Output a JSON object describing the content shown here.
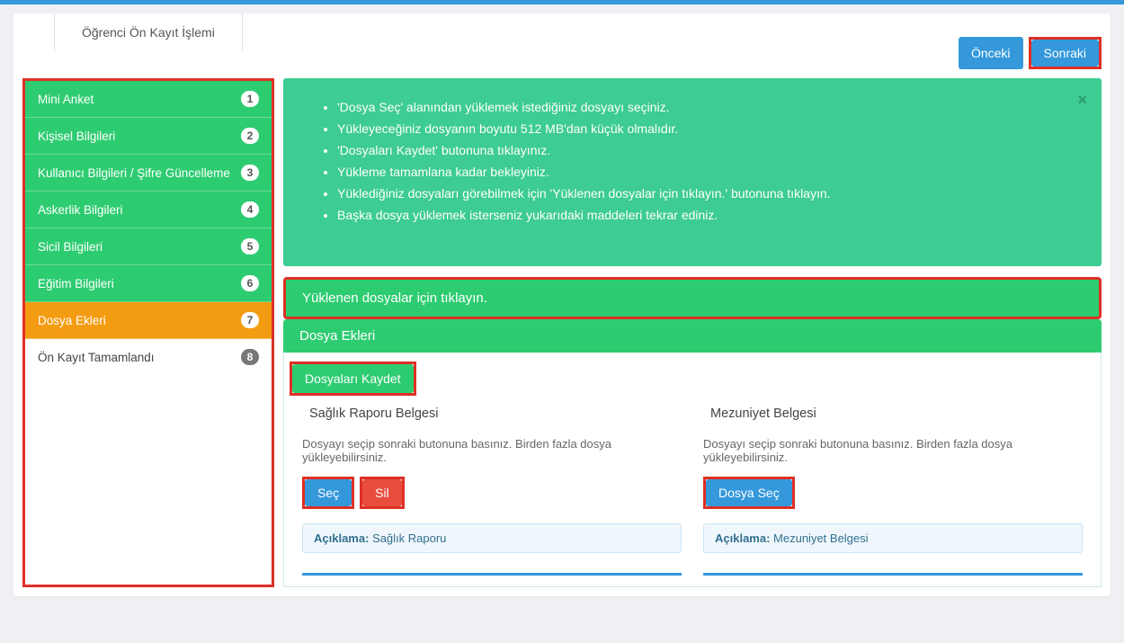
{
  "header": {
    "tab_title": "Öğrenci Ön Kayıt İşlemi",
    "prev_label": "Önceki",
    "next_label": "Sonraki"
  },
  "sidebar": {
    "items": [
      {
        "label": "Mini Anket",
        "num": "1",
        "style": "green"
      },
      {
        "label": "Kişisel Bilgileri",
        "num": "2",
        "style": "green"
      },
      {
        "label": "Kullanıcı Bilgileri / Şifre Güncelleme",
        "num": "3",
        "style": "green"
      },
      {
        "label": "Askerlik Bilgileri",
        "num": "4",
        "style": "green"
      },
      {
        "label": "Sicil Bilgileri",
        "num": "5",
        "style": "green"
      },
      {
        "label": "Eğitim Bilgileri",
        "num": "6",
        "style": "green"
      },
      {
        "label": "Dosya Ekleri",
        "num": "7",
        "style": "orange"
      },
      {
        "label": "Ön Kayıt Tamamlandı",
        "num": "8",
        "style": "white"
      }
    ]
  },
  "infobox": {
    "lines": [
      "'Dosya Seç' alanından yüklemek istediğiniz dosyayı seçiniz.",
      "Yükleyeceğiniz dosyanın boyutu 512 MB'dan küçük olmalıdır.",
      "'Dosyaları Kaydet' butonuna tıklayınız.",
      "Yükleme tamamlana kadar bekleyiniz.",
      "Yüklediğiniz dosyaları görebilmek için 'Yüklenen dosyalar için tıklayın.' butonuna tıklayın.",
      "Başka dosya yüklemek isterseniz yukarıdaki maddeleri tekrar ediniz."
    ]
  },
  "uploaded_bar_label": "Yüklenen dosyalar için tıklayın.",
  "panel_title": "Dosya Ekleri",
  "save_files_label": "Dosyaları Kaydet",
  "columns": {
    "left": {
      "title": "Sağlık Raporu Belgesi",
      "desc": "Dosyayı seçip sonraki butonuna basınız. Birden fazla dosya yükleyebilirsiniz.",
      "select_label": "Seç",
      "delete_label": "Sil",
      "note_label": "Açıklama:",
      "note_value": " Sağlık Raporu"
    },
    "right": {
      "title": "Mezuniyet Belgesi",
      "desc": "Dosyayı seçip sonraki butonuna basınız. Birden fazla dosya yükleyebilirsiniz.",
      "select_label": "Dosya Seç",
      "note_label": "Açıklama:",
      "note_value": " Mezuniyet Belgesi"
    }
  }
}
